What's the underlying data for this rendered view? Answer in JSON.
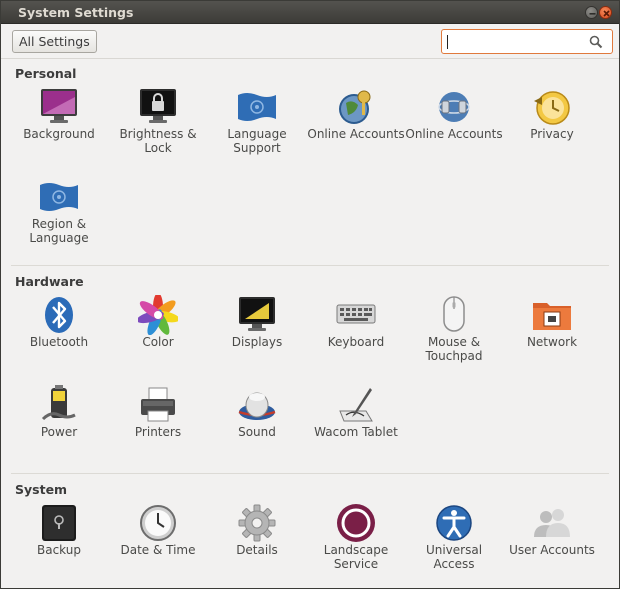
{
  "window": {
    "title": "System Settings"
  },
  "toolbar": {
    "all_settings_label": "All Settings",
    "search_value": "",
    "search_placeholder": ""
  },
  "sections": [
    {
      "title": "Personal",
      "items": [
        {
          "label": "Background",
          "icon": "background-icon"
        },
        {
          "label": "Brightness & Lock",
          "icon": "brightness-lock-icon"
        },
        {
          "label": "Language Support",
          "icon": "language-support-icon"
        },
        {
          "label": "Online Accounts",
          "icon": "online-accounts-icon"
        },
        {
          "label": "Online Accounts",
          "icon": "online-accounts-alt-icon"
        },
        {
          "label": "Privacy",
          "icon": "privacy-icon"
        },
        {
          "label": "Region & Language",
          "icon": "region-language-icon"
        }
      ]
    },
    {
      "title": "Hardware",
      "items": [
        {
          "label": "Bluetooth",
          "icon": "bluetooth-icon"
        },
        {
          "label": "Color",
          "icon": "color-icon"
        },
        {
          "label": "Displays",
          "icon": "displays-icon"
        },
        {
          "label": "Keyboard",
          "icon": "keyboard-icon"
        },
        {
          "label": "Mouse & Touchpad",
          "icon": "mouse-icon"
        },
        {
          "label": "Network",
          "icon": "network-icon"
        },
        {
          "label": "Power",
          "icon": "power-icon"
        },
        {
          "label": "Printers",
          "icon": "printer-icon"
        },
        {
          "label": "Sound",
          "icon": "sound-icon"
        },
        {
          "label": "Wacom Tablet",
          "icon": "wacom-tablet-icon"
        }
      ]
    },
    {
      "title": "System",
      "items": [
        {
          "label": "Backup",
          "icon": "backup-icon"
        },
        {
          "label": "Date & Time",
          "icon": "clock-icon"
        },
        {
          "label": "Details",
          "icon": "gear-icon"
        },
        {
          "label": "Landscape Service",
          "icon": "landscape-icon"
        },
        {
          "label": "Universal Access",
          "icon": "accessibility-icon"
        },
        {
          "label": "User Accounts",
          "icon": "users-icon"
        }
      ]
    }
  ],
  "colors": {
    "accent": "#e0793c",
    "titlebar": "#3c3b37",
    "close": "#df4a16"
  }
}
